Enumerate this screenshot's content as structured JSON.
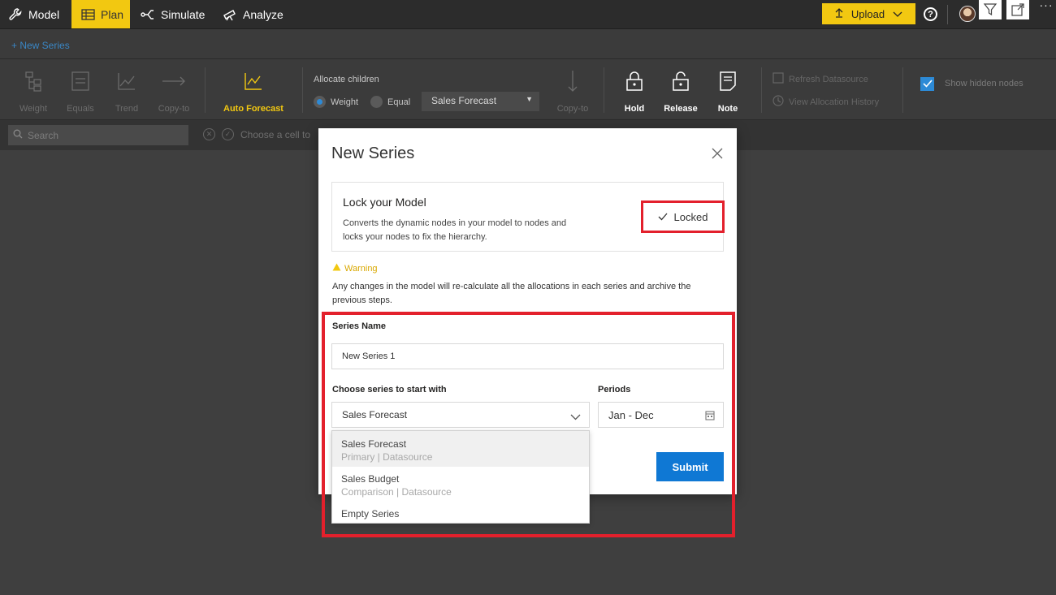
{
  "nav": {
    "items": [
      {
        "label": "Model",
        "icon": "wrench-icon"
      },
      {
        "label": "Plan",
        "icon": "table-icon"
      },
      {
        "label": "Simulate",
        "icon": "branch-icon"
      },
      {
        "label": "Analyze",
        "icon": "telescope-icon"
      }
    ],
    "upload_label": "Upload",
    "help_label": "?"
  },
  "series_bar": {
    "new_series_label": "+ New Series"
  },
  "ribbon": {
    "buttons": {
      "weight": "Weight",
      "equals": "Equals",
      "trend": "Trend",
      "copy_to": "Copy-to",
      "auto_forecast": "Auto Forecast",
      "copy_to_2": "Copy-to",
      "hold": "Hold",
      "release": "Release",
      "note": "Note"
    },
    "allocate": {
      "title": "Allocate children",
      "weight_label": "Weight",
      "equal_label": "Equal",
      "selected_series": "Sales Forecast"
    },
    "refresh_label": "Refresh Datasource",
    "history_label": "View Allocation History",
    "show_hidden_label": "Show hidden nodes"
  },
  "search": {
    "placeholder": "Search",
    "hint": "Choose a cell to"
  },
  "dialog": {
    "title": "New Series",
    "lock_card": {
      "title": "Lock your Model",
      "description": "Converts the dynamic nodes in your model to nodes and locks your nodes to fix the hierarchy.",
      "locked_label": "Locked"
    },
    "warning": {
      "title": "Warning",
      "text": "Any changes in the model will re-calculate all the allocations in each series and archive the previous steps."
    },
    "series_name_label": "Series Name",
    "series_name_value": "New Series 1",
    "choose_series_label": "Choose series to start with",
    "choose_series_value": "Sales Forecast",
    "periods_label": "Periods",
    "periods_value": "Jan - Dec",
    "submit_label": "Submit"
  },
  "dropdown": {
    "options": [
      {
        "name": "Sales Forecast",
        "sub": "Primary | Datasource"
      },
      {
        "name": "Sales Budget",
        "sub": "Comparison | Datasource"
      },
      {
        "name": "Empty Series",
        "sub": ""
      }
    ]
  },
  "colors": {
    "accent_yellow": "#f2c811",
    "primary_blue": "#0f78d4",
    "highlight_red": "#e3202c"
  }
}
